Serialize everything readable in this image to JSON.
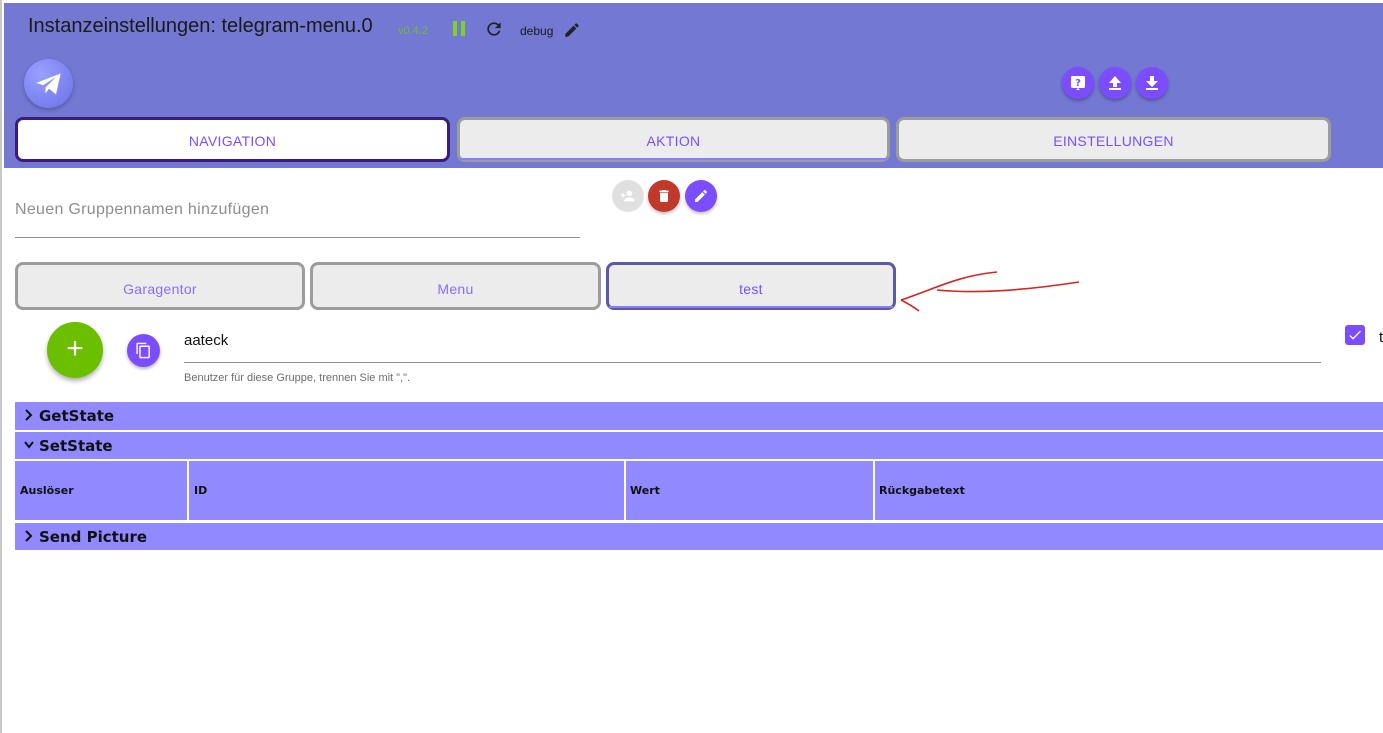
{
  "title_bar": {
    "title": "Instanzeinstellungen: telegram-menu.0",
    "version": "v0.4.2",
    "log_level": "debug"
  },
  "header": {
    "logo_icon": "telegram-plane-icon",
    "buttons": [
      "help-icon",
      "upload-icon",
      "download-icon"
    ],
    "tabs": [
      {
        "label": "NAVIGATION",
        "active": true
      },
      {
        "label": "AKTION",
        "active": false
      },
      {
        "label": "EINSTELLUNGEN",
        "active": false
      }
    ]
  },
  "group": {
    "placeholder": "Neuen Gruppennamen hinzufügen",
    "actions": [
      "add-group-icon",
      "delete-icon",
      "edit-icon"
    ],
    "tabs": [
      {
        "label": "Garagentor",
        "active": false
      },
      {
        "label": "Menu",
        "active": false
      },
      {
        "label": "test",
        "active": true
      }
    ]
  },
  "users": {
    "value": "aateck",
    "helper": "Benutzer für diese Gruppe, trennen Sie mit \",\".",
    "checkbox_checked": true,
    "checkbox_label": "t"
  },
  "accordion": [
    {
      "label": "GetState",
      "expanded": false
    },
    {
      "label": "SetState",
      "expanded": true
    },
    {
      "label": "Send Picture",
      "expanded": false
    }
  ],
  "setstate_table": {
    "columns": [
      "Auslöser",
      "ID",
      "Wert",
      "Rückgabetext"
    ]
  },
  "colors": {
    "header": "#7378d3",
    "accent": "#7c4dff",
    "accordion": "#9089ff",
    "fab": "#6cbf00",
    "delete": "#c0392b"
  }
}
